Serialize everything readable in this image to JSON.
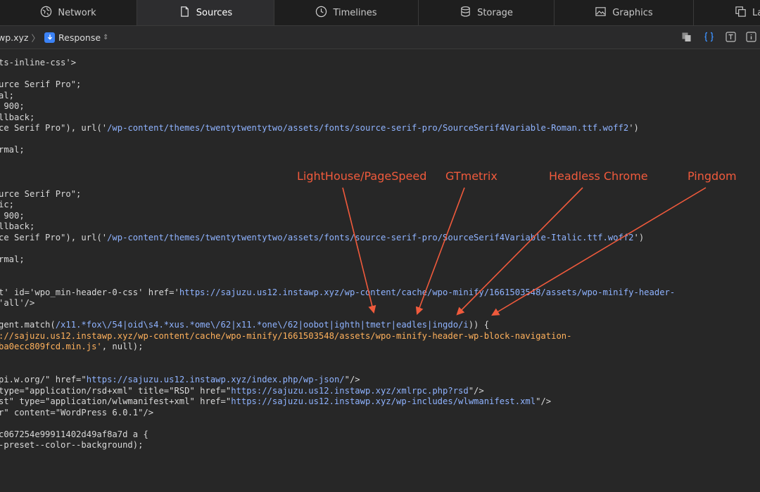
{
  "tabs": [
    {
      "label": "Network",
      "icon": "globe-icon"
    },
    {
      "label": "Sources",
      "icon": "document-icon"
    },
    {
      "label": "Timelines",
      "icon": "clock-icon"
    },
    {
      "label": "Storage",
      "icon": "database-icon"
    },
    {
      "label": "Graphics",
      "icon": "image-icon"
    },
    {
      "label": "La",
      "icon": "layers-icon"
    }
  ],
  "toolbar": {
    "breadcrumb_domain": "wp.xyz",
    "response_label": "Response"
  },
  "code_lines": [
    {
      "segments": [
        {
          "text": "ts-inline-css'>",
          "t": "p"
        }
      ]
    },
    {
      "segments": [
        {
          "text": "",
          "t": "p"
        }
      ]
    },
    {
      "segments": [
        {
          "text": "urce Serif Pro\";",
          "t": "p"
        }
      ]
    },
    {
      "segments": [
        {
          "text": "al;",
          "t": "p"
        }
      ]
    },
    {
      "segments": [
        {
          "text": " 900;",
          "t": "p"
        }
      ]
    },
    {
      "segments": [
        {
          "text": "llback;",
          "t": "p"
        }
      ]
    },
    {
      "segments": [
        {
          "text": "ce Serif Pro\"), url('",
          "t": "p"
        },
        {
          "text": "/wp-content/themes/twentytwentytwo/assets/fonts/source-serif-pro/SourceSerif4Variable-Roman.ttf.woff2",
          "t": "s"
        },
        {
          "text": "')",
          "t": "p"
        }
      ]
    },
    {
      "segments": [
        {
          "text": "",
          "t": "p"
        }
      ]
    },
    {
      "segments": [
        {
          "text": "rmal;",
          "t": "p"
        }
      ]
    },
    {
      "segments": [
        {
          "text": "",
          "t": "p"
        }
      ]
    },
    {
      "segments": [
        {
          "text": "",
          "t": "p"
        }
      ]
    },
    {
      "segments": [
        {
          "text": "",
          "t": "p"
        }
      ]
    },
    {
      "segments": [
        {
          "text": "urce Serif Pro\";",
          "t": "p"
        }
      ]
    },
    {
      "segments": [
        {
          "text": "ic;",
          "t": "p"
        }
      ]
    },
    {
      "segments": [
        {
          "text": " 900;",
          "t": "p"
        }
      ]
    },
    {
      "segments": [
        {
          "text": "llback;",
          "t": "p"
        }
      ]
    },
    {
      "segments": [
        {
          "text": "ce Serif Pro\"), url('",
          "t": "p"
        },
        {
          "text": "/wp-content/themes/twentytwentytwo/assets/fonts/source-serif-pro/SourceSerif4Variable-Italic.ttf.woff2",
          "t": "s"
        },
        {
          "text": "')",
          "t": "p"
        }
      ]
    },
    {
      "segments": [
        {
          "text": "",
          "t": "p"
        }
      ]
    },
    {
      "segments": [
        {
          "text": "rmal;",
          "t": "p"
        }
      ]
    },
    {
      "segments": [
        {
          "text": "",
          "t": "p"
        }
      ]
    },
    {
      "segments": [
        {
          "text": "",
          "t": "p"
        }
      ]
    },
    {
      "segments": [
        {
          "text": "t' id='wpo_min-header-0-css' href='",
          "t": "p"
        },
        {
          "text": "https://sajuzu.us12.instawp.xyz/wp-content/cache/wpo-minify/1661503548/assets/wpo-minify-header-",
          "t": "s"
        }
      ]
    },
    {
      "segments": [
        {
          "text": "'all'/>",
          "t": "p"
        }
      ]
    },
    {
      "segments": [
        {
          "text": "",
          "t": "p"
        }
      ]
    },
    {
      "segments": [
        {
          "text": "gent.match(",
          "t": "p"
        },
        {
          "text": "/x11.*fox\\/54|oid\\s4.*xus.*ome\\/62|x11.*one\\/62|oobot|ighth|tmetr|eadles|ingdo/i",
          "t": "s"
        },
        {
          "text": ")) {",
          "t": "p"
        }
      ]
    },
    {
      "segments": [
        {
          "text": "://sajuzu.us12.instawp.xyz/wp-content/cache/wpo-minify/1661503548/assets/wpo-minify-header-wp-block-navigation-",
          "t": "o"
        }
      ]
    },
    {
      "segments": [
        {
          "text": "ba0ecc809fcd.min.js'",
          "t": "o"
        },
        {
          "text": ", null);",
          "t": "p"
        }
      ]
    },
    {
      "segments": [
        {
          "text": "",
          "t": "p"
        }
      ]
    },
    {
      "segments": [
        {
          "text": "",
          "t": "p"
        }
      ]
    },
    {
      "segments": [
        {
          "text": "pi.w.org/\" href=\"",
          "t": "p"
        },
        {
          "text": "https://sajuzu.us12.instawp.xyz/index.php/wp-json/",
          "t": "s"
        },
        {
          "text": "\"/>",
          "t": "p"
        }
      ]
    },
    {
      "segments": [
        {
          "text": "type=\"application/rsd+xml\" title=\"RSD\" href=\"",
          "t": "p"
        },
        {
          "text": "https://sajuzu.us12.instawp.xyz/xmlrpc.php?rsd",
          "t": "s"
        },
        {
          "text": "\"/>",
          "t": "p"
        }
      ]
    },
    {
      "segments": [
        {
          "text": "st\" type=\"application/wlwmanifest+xml\" href=\"",
          "t": "p"
        },
        {
          "text": "https://sajuzu.us12.instawp.xyz/wp-includes/wlwmanifest.xml",
          "t": "s"
        },
        {
          "text": "\"/>",
          "t": "p"
        }
      ]
    },
    {
      "segments": [
        {
          "text": "r\" content=\"WordPress 6.0.1\"/>",
          "t": "p"
        }
      ]
    },
    {
      "segments": [
        {
          "text": "",
          "t": "p"
        }
      ]
    },
    {
      "segments": [
        {
          "text": "c067254e99911402d49af8a7d a {",
          "t": "p"
        }
      ]
    },
    {
      "segments": [
        {
          "text": "-preset--color--background);",
          "t": "p"
        }
      ]
    }
  ],
  "annotations": [
    {
      "label": "LightHouse/PageSpeed"
    },
    {
      "label": "GTmetrix"
    },
    {
      "label": "Headless Chrome"
    },
    {
      "label": "Pingdom"
    }
  ],
  "colors": {
    "background": "#272727",
    "annotation": "#f05a3c",
    "string_blue": "#8fb3ff",
    "string_orange": "#ffb15c",
    "plain_text": "#d9d9d9"
  }
}
